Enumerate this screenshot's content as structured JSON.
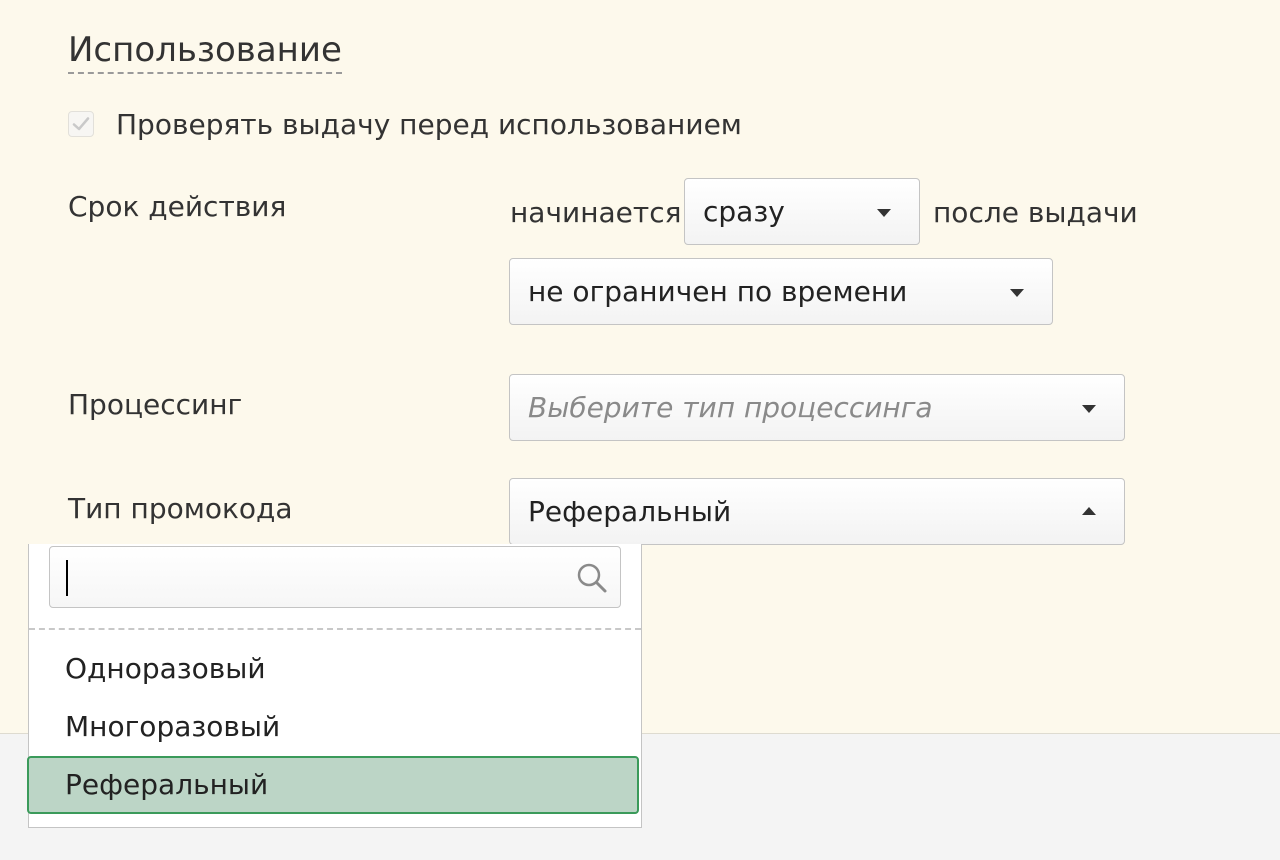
{
  "section": {
    "title": "Использование"
  },
  "check_before_use": {
    "label": "Проверять выдачу перед использованием",
    "checked": true
  },
  "validity": {
    "label": "Срок действия",
    "starts_text": "начинается",
    "start_select_value": "сразу",
    "after_text": "после выдачи",
    "duration_select_value": "не ограничен по времени"
  },
  "processing": {
    "label": "Процессинг",
    "placeholder": "Выберите тип процессинга"
  },
  "promo_type": {
    "label": "Тип промокода",
    "selected_value": "Реферальный",
    "dropdown_open": true,
    "search_value": "",
    "options": [
      {
        "label": "Одноразовый",
        "selected": false
      },
      {
        "label": "Многоразовый",
        "selected": false
      },
      {
        "label": "Реферальный",
        "selected": true
      }
    ]
  },
  "colors": {
    "panel_background": "#fdf9ec",
    "selected_option_background": "#bcd5c6",
    "selected_option_border": "#3a9a5a"
  }
}
